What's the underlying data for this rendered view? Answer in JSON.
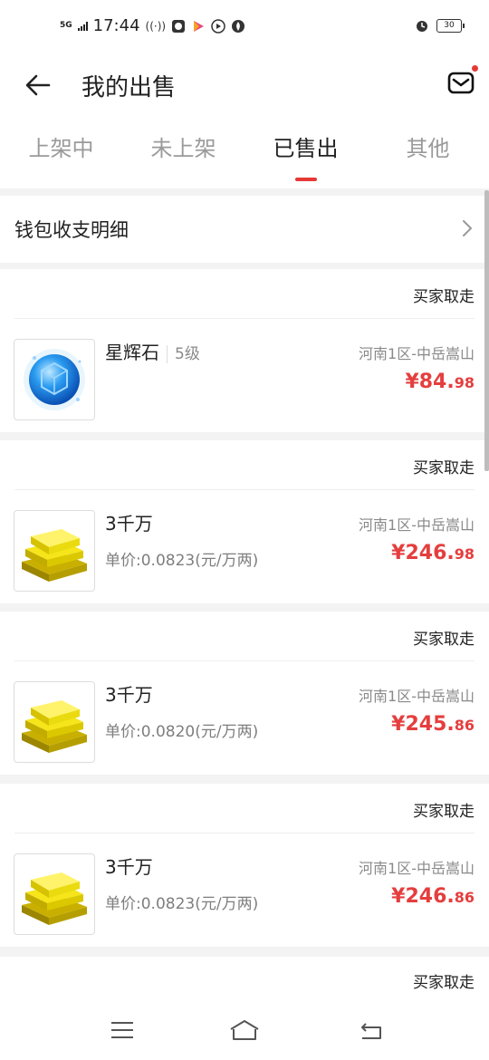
{
  "status_bar": {
    "network": "5G",
    "time": "17:44",
    "battery": "30",
    "icons": [
      "hotspot-icon",
      "qq-icon",
      "video-icon",
      "play-icon",
      "fire-icon",
      "alarm-icon",
      "battery-icon"
    ]
  },
  "header": {
    "title": "我的出售",
    "back_icon": "back-arrow-icon",
    "mail_icon": "mail-icon"
  },
  "tabs": [
    {
      "label": "上架中",
      "active": false
    },
    {
      "label": "未上架",
      "active": false
    },
    {
      "label": "已售出",
      "active": true
    },
    {
      "label": "其他",
      "active": false
    }
  ],
  "wallet": {
    "label": "钱包收支明细"
  },
  "orders": [
    {
      "status": "买家取走",
      "name": "星辉石",
      "level": "5级",
      "unit_price": "",
      "server": "河南1区-中岳嵩山",
      "currency": "¥",
      "price_int": "84.",
      "price_dec": "98",
      "image": "blue-gem"
    },
    {
      "status": "买家取走",
      "name": "3千万",
      "level": "",
      "unit_price": "单价:0.0823(元/万两)",
      "server": "河南1区-中岳嵩山",
      "currency": "¥",
      "price_int": "246.",
      "price_dec": "98",
      "image": "gold-bars"
    },
    {
      "status": "买家取走",
      "name": "3千万",
      "level": "",
      "unit_price": "单价:0.0820(元/万两)",
      "server": "河南1区-中岳嵩山",
      "currency": "¥",
      "price_int": "245.",
      "price_dec": "86",
      "image": "gold-bars"
    },
    {
      "status": "买家取走",
      "name": "3千万",
      "level": "",
      "unit_price": "单价:0.0823(元/万两)",
      "server": "河南1区-中岳嵩山",
      "currency": "¥",
      "price_int": "246.",
      "price_dec": "86",
      "image": "gold-bars"
    }
  ],
  "partial_order": {
    "status": "买家取走"
  },
  "colors": {
    "accent": "#e53935",
    "price": "#e53e3e",
    "muted": "#8a8a8a"
  }
}
